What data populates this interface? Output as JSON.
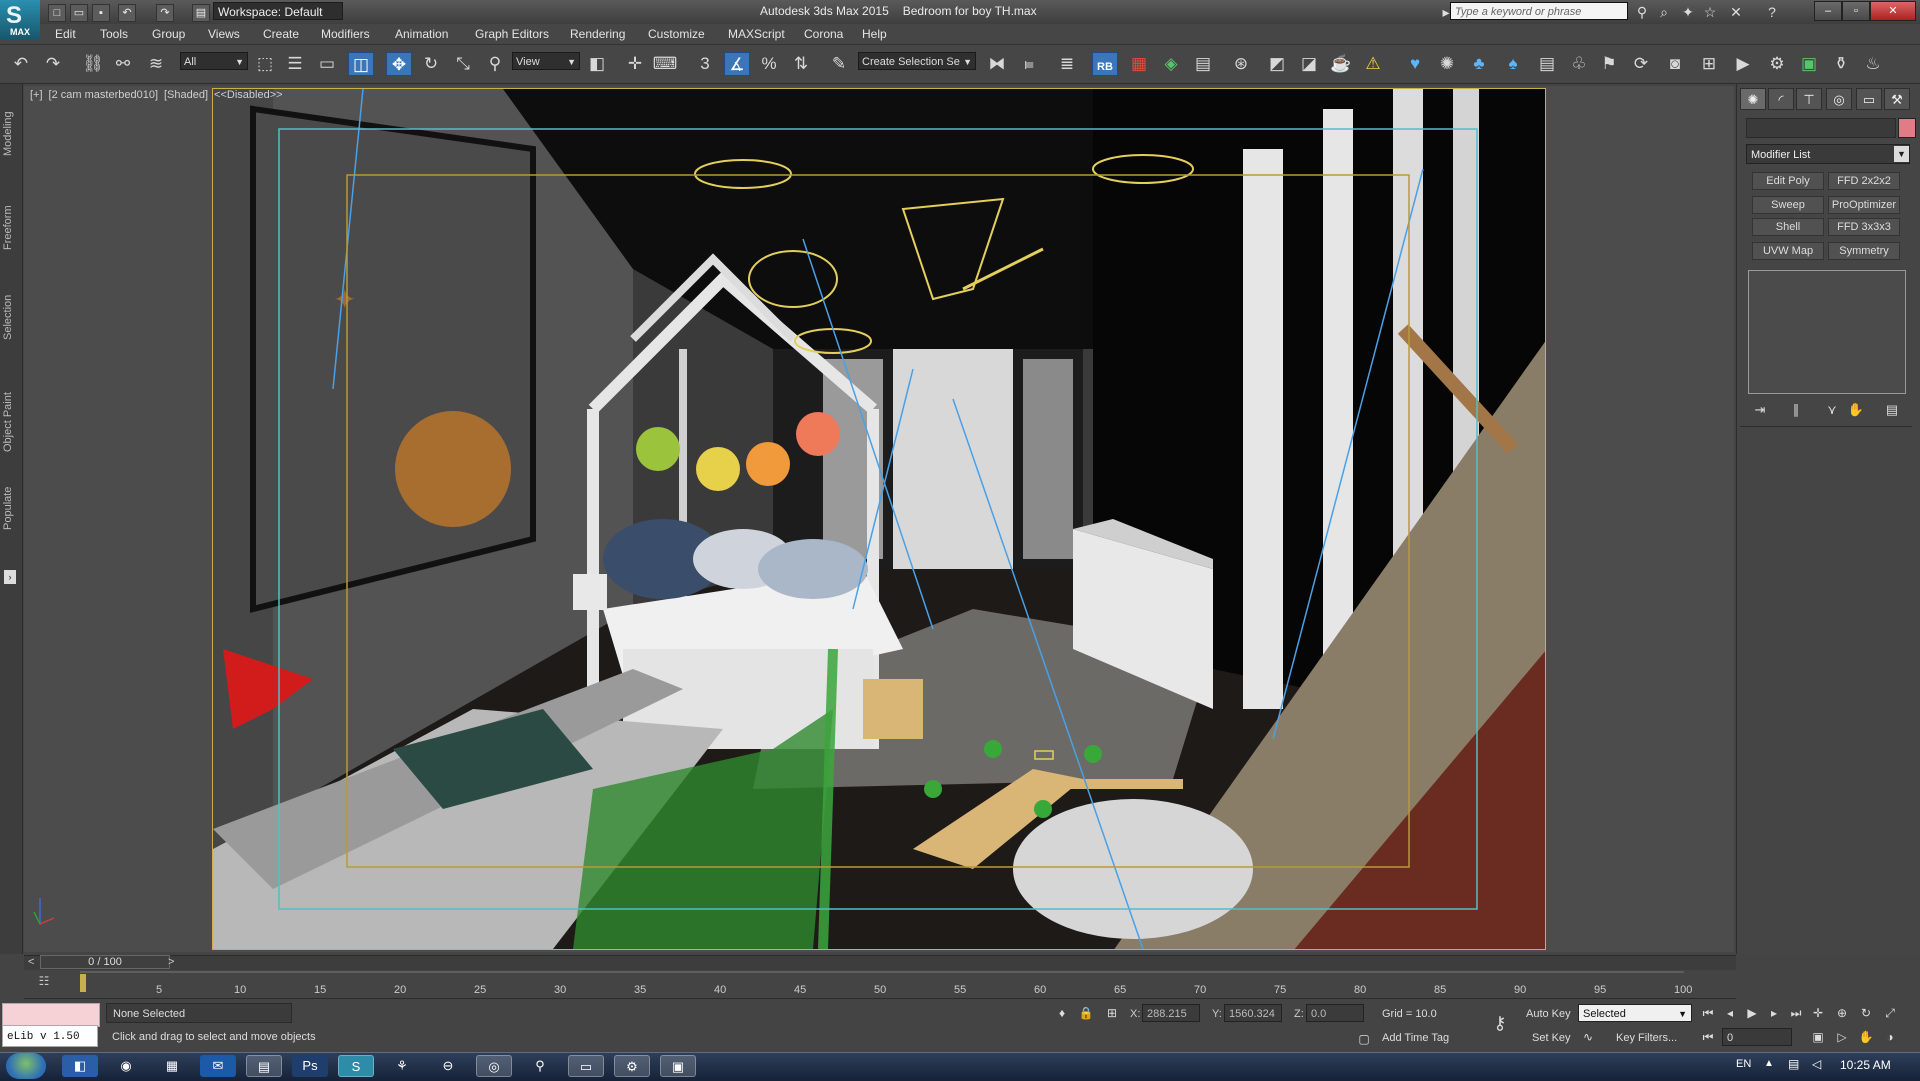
{
  "titlebar": {
    "workspace": "Workspace: Default",
    "app_name": "Autodesk 3ds Max 2015",
    "file_name": "Bedroom for boy TH.max",
    "search_placeholder": "Type a keyword or phrase",
    "logo_text": "MAX",
    "logo_symbol": "S"
  },
  "menu": [
    "Edit",
    "Tools",
    "Group",
    "Views",
    "Create",
    "Modifiers",
    "Animation",
    "Graph Editors",
    "Rendering",
    "Customize",
    "MAXScript",
    "Corona",
    "Help"
  ],
  "toolbar": {
    "selection_filter": "All",
    "ref_coord": "View",
    "named_selection_placeholder": "Create Selection Se",
    "snap_label": "3",
    "angle_snap_label": "%",
    "rb_label": "RB"
  },
  "left_tabs": [
    "Modeling",
    "Freeform",
    "Selection",
    "Object Paint",
    "Populate"
  ],
  "viewport": {
    "label_parts": [
      "[+]",
      "[2 cam masterbed010]",
      "[Shaded]",
      "<<Disabled>>"
    ]
  },
  "command_panel": {
    "modifier_list": "Modifier List",
    "modifier_buttons": [
      "Edit Poly",
      "FFD 2x2x2",
      "Sweep",
      "ProOptimizer",
      "Shell",
      "FFD 3x3x3",
      "UVW Map",
      "Symmetry"
    ]
  },
  "timeline": {
    "frame_display": "0 / 100",
    "ticks": [
      "5",
      "10",
      "15",
      "20",
      "25",
      "30",
      "35",
      "40",
      "45",
      "50",
      "55",
      "60",
      "65",
      "70",
      "75",
      "80",
      "85",
      "90",
      "95",
      "100"
    ],
    "prev_label": "<",
    "next_label": ">"
  },
  "status": {
    "selection": "None Selected",
    "prompt": "Click and drag to select and move objects",
    "maxscript_text": "eLib v 1.50",
    "x_label": "X:",
    "x_value": "288.215",
    "y_label": "Y:",
    "y_value": "1560.324",
    "z_label": "Z:",
    "z_value": "0.0",
    "grid": "Grid = 10.0",
    "add_time_tag": "Add Time Tag",
    "auto_key": "Auto Key",
    "set_key": "Set Key",
    "key_mode": "Selected",
    "key_filters": "Key Filters...",
    "current_frame": "0"
  },
  "taskbar": {
    "language": "EN",
    "time": "10:25 AM"
  },
  "colors": {
    "accent": "#3b77b8",
    "render_frame": "#c8b14a",
    "safe_frame": "#4fc0c8",
    "object_color": "#e07b88"
  }
}
